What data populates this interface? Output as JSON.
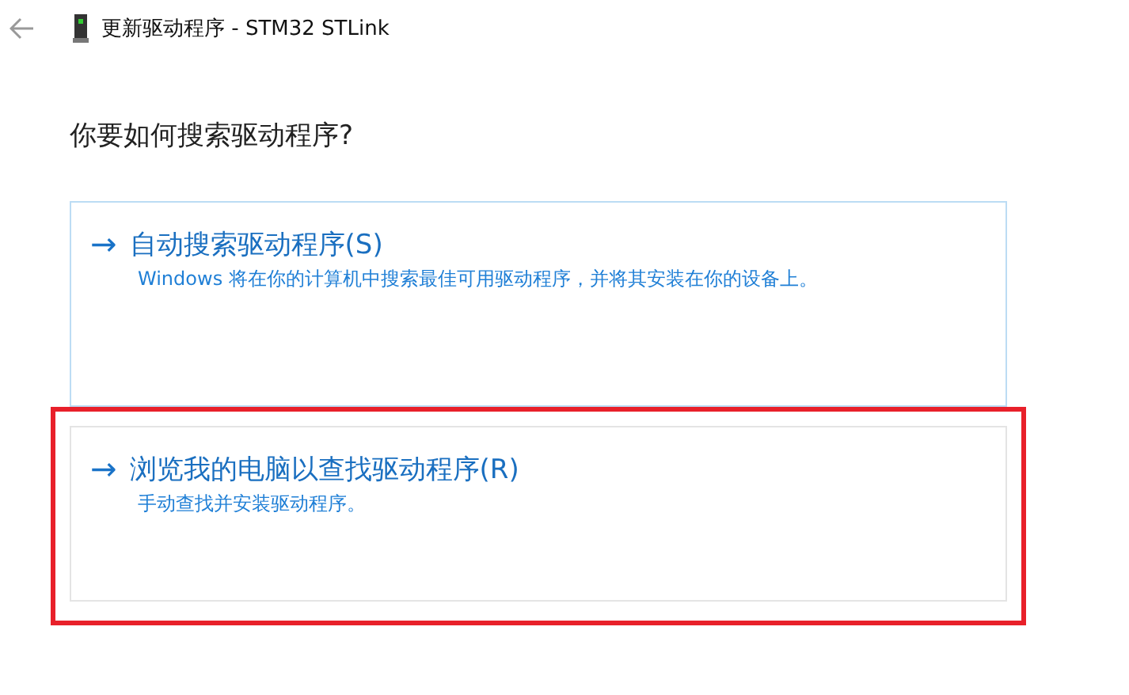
{
  "window": {
    "title": "更新驱动程序 - STM32 STLink"
  },
  "heading": "你要如何搜索驱动程序?",
  "options": [
    {
      "arrow": "→",
      "title": "自动搜索驱动程序(S)",
      "description": "Windows 将在你的计算机中搜索最佳可用驱动程序，并将其安装在你的设备上。",
      "hovered": true,
      "highlighted": false
    },
    {
      "arrow": "→",
      "title": "浏览我的电脑以查找驱动程序(R)",
      "description": "手动查找并安装驱动程序。",
      "hovered": false,
      "highlighted": true
    }
  ]
}
